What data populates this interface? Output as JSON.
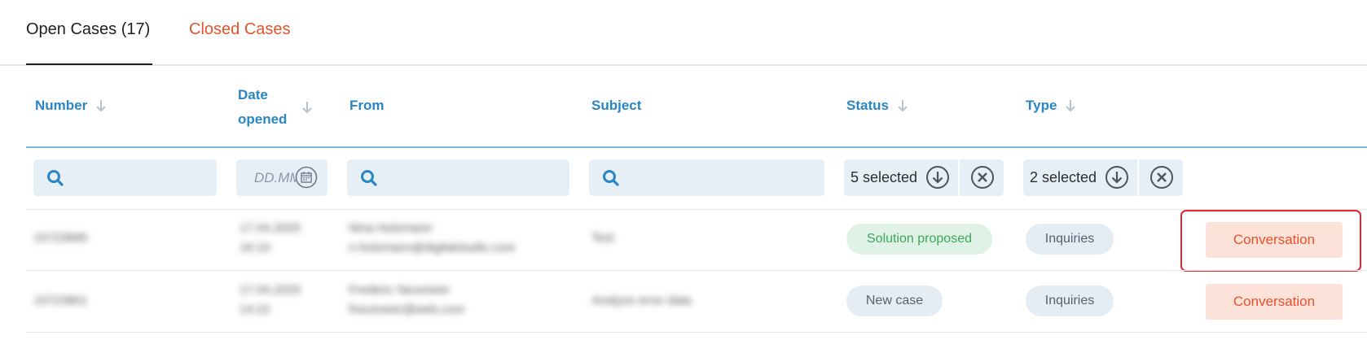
{
  "tabs": {
    "open": "Open Cases (17)",
    "closed": "Closed Cases"
  },
  "columns": {
    "number": "Number",
    "date_opened_line1": "Date",
    "date_opened_line2": "opened",
    "from": "From",
    "subject": "Subject",
    "status": "Status",
    "type": "Type"
  },
  "filters": {
    "date_placeholder": "DD.MM",
    "status_selected": "5 selected",
    "type_selected": "2 selected"
  },
  "rows": [
    {
      "number": "15723895",
      "date_line1": "17.04.2025",
      "date_line2": "16:10",
      "from_line1": "Nina Holzmann",
      "from_line2": "n.holzmann@digitalstudio.com",
      "subject": "Test",
      "status": "Solution proposed",
      "type": "Inquiries",
      "action": "Conversation"
    },
    {
      "number": "15723801",
      "date_line1": "17.04.2025",
      "date_line2": "14:22",
      "from_line1": "Frederic Neumeier",
      "from_line2": "fneumeier@web.com",
      "subject": "Analyze error data",
      "status": "New case",
      "type": "Inquiries",
      "action": "Conversation"
    }
  ],
  "colors": {
    "accent": "#2a85c5",
    "orange": "#e5522c"
  }
}
